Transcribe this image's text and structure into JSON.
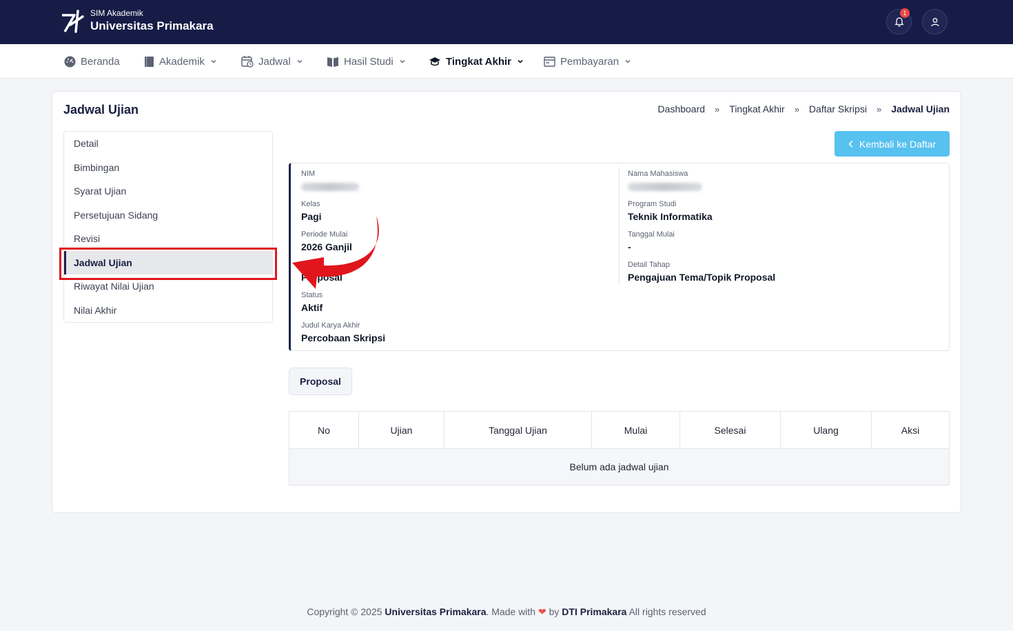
{
  "header": {
    "brand_sub": "SIM Akademik",
    "brand_main": "Universitas Primakara",
    "notification_count": "1"
  },
  "nav": {
    "items": [
      {
        "label": "Beranda",
        "icon": "dashboard-icon"
      },
      {
        "label": "Akademik",
        "icon": "book-icon"
      },
      {
        "label": "Jadwal",
        "icon": "calendar-icon"
      },
      {
        "label": "Hasil Studi",
        "icon": "open-book-icon"
      },
      {
        "label": "Tingkat Akhir",
        "icon": "graduation-cap-icon"
      },
      {
        "label": "Pembayaran",
        "icon": "payment-icon"
      }
    ]
  },
  "page": {
    "title": "Jadwal Ujian",
    "breadcrumb": [
      "Dashboard",
      "Tingkat Akhir",
      "Daftar Skripsi",
      "Jadwal Ujian"
    ],
    "breadcrumb_sep": "»",
    "back_button": "Kembali ke Daftar"
  },
  "sidemenu": {
    "items": [
      "Detail",
      "Bimbingan",
      "Syarat Ujian",
      "Persetujuan Sidang",
      "Revisi",
      "Jadwal Ujian",
      "Riwayat Nilai Ujian",
      "Nilai Akhir"
    ],
    "active": "Jadwal Ujian"
  },
  "info": {
    "nim_label": "NIM",
    "nama_label": "Nama Mahasiswa",
    "kelas_label": "Kelas",
    "kelas_value": "Pagi",
    "prodi_label": "Program Studi",
    "prodi_value": "Teknik Informatika",
    "periode_label": "Periode Mulai",
    "periode_value": "2026 Ganjil",
    "tanggal_label": "Tanggal Mulai",
    "tanggal_value": "-",
    "tahap_value": "Proposal",
    "detail_tahap_label": "Detail Tahap",
    "detail_tahap_value": "Pengajuan Tema/Topik Proposal",
    "status_label": "Status",
    "status_value": "Aktif",
    "judul_label": "Judul Karya Akhir",
    "judul_value": "Percobaan Skripsi"
  },
  "tabs": [
    "Proposal"
  ],
  "table": {
    "headers": [
      "No",
      "Ujian",
      "Tanggal Ujian",
      "Mulai",
      "Selesai",
      "Ulang",
      "Aksi"
    ],
    "empty_text": "Belum ada jadwal ujian"
  },
  "footer": {
    "prefix": "Copyright © 2025 ",
    "org": "Universitas Primakara",
    "made_with": ". Made with ",
    "heart": "❤",
    "by": " by ",
    "team": "DTI Primakara",
    "suffix": " All rights reserved"
  },
  "colors": {
    "header_bg": "#161c46",
    "accent_button": "#57c1f0",
    "highlight_red": "#e0161c"
  }
}
